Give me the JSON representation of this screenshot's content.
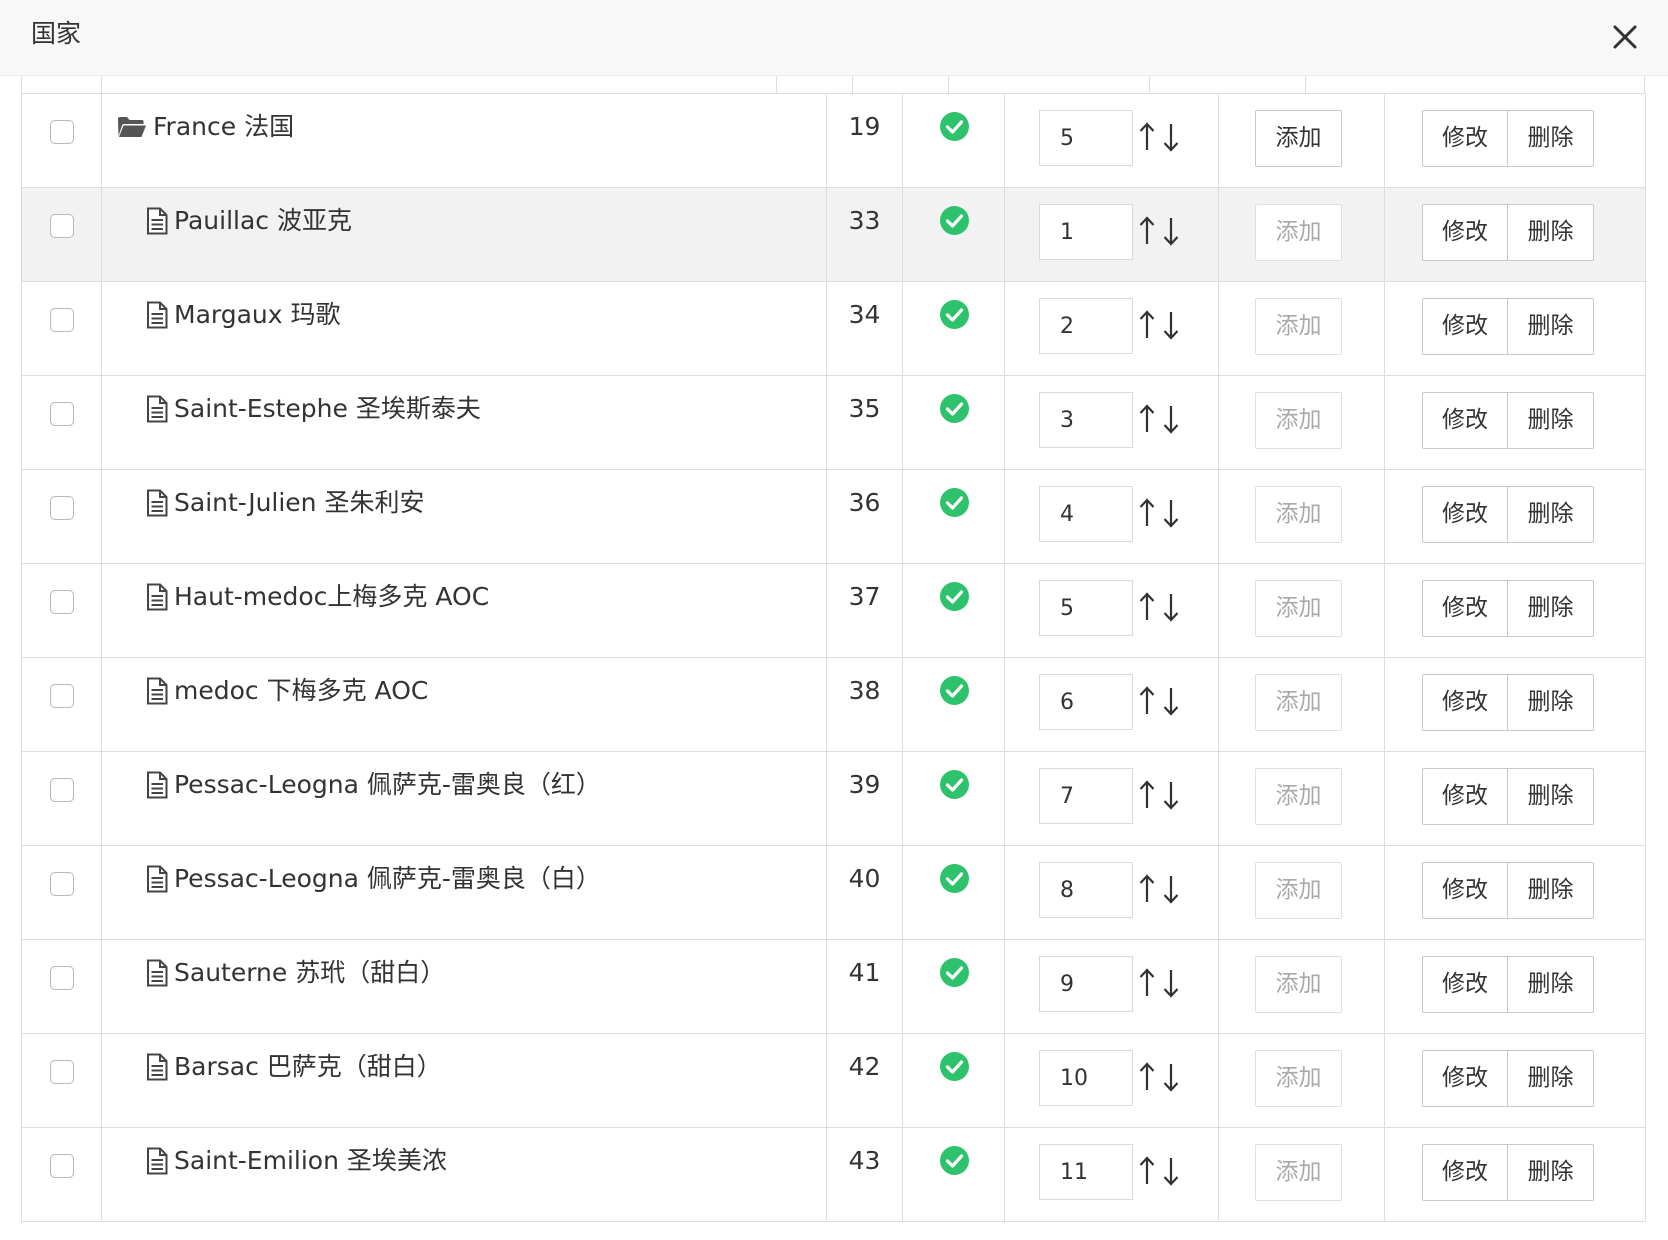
{
  "dialog": {
    "title": "国家"
  },
  "colors": {
    "success": "#2dc26b",
    "highlight_row": "#f2f2f2",
    "border": "#dddddd"
  },
  "icons": {
    "close": "close-icon",
    "root_item": "folder-open-icon",
    "child_item": "file-text-icon",
    "status": "check-circle-icon",
    "sort_up": "arrow-up-icon",
    "sort_down": "arrow-down-icon"
  },
  "labels": {
    "add": "添加",
    "edit": "修改",
    "delete": "删除"
  },
  "rows": [
    {
      "name": "France 法国",
      "id": "19",
      "order": "5",
      "level": "root",
      "add_enabled": true,
      "highlighted": false,
      "checked": false,
      "status": "enabled"
    },
    {
      "name": "Pauillac 波亚克",
      "id": "33",
      "order": "1",
      "level": "child",
      "add_enabled": false,
      "highlighted": true,
      "checked": false,
      "status": "enabled"
    },
    {
      "name": "Margaux 玛歌",
      "id": "34",
      "order": "2",
      "level": "child",
      "add_enabled": false,
      "highlighted": false,
      "checked": false,
      "status": "enabled"
    },
    {
      "name": "Saint-Estephe 圣埃斯泰夫",
      "id": "35",
      "order": "3",
      "level": "child",
      "add_enabled": false,
      "highlighted": false,
      "checked": false,
      "status": "enabled"
    },
    {
      "name": "Saint-Julien 圣朱利安",
      "id": "36",
      "order": "4",
      "level": "child",
      "add_enabled": false,
      "highlighted": false,
      "checked": false,
      "status": "enabled"
    },
    {
      "name": "Haut-medoc上梅多克 AOC",
      "id": "37",
      "order": "5",
      "level": "child",
      "add_enabled": false,
      "highlighted": false,
      "checked": false,
      "status": "enabled"
    },
    {
      "name": "medoc 下梅多克 AOC",
      "id": "38",
      "order": "6",
      "level": "child",
      "add_enabled": false,
      "highlighted": false,
      "checked": false,
      "status": "enabled"
    },
    {
      "name": "Pessac-Leogna 佩萨克-雷奥良（红）",
      "id": "39",
      "order": "7",
      "level": "child",
      "add_enabled": false,
      "highlighted": false,
      "checked": false,
      "status": "enabled"
    },
    {
      "name": "Pessac-Leogna 佩萨克-雷奥良（白）",
      "id": "40",
      "order": "8",
      "level": "child",
      "add_enabled": false,
      "highlighted": false,
      "checked": false,
      "status": "enabled"
    },
    {
      "name": "Sauterne 苏玳（甜白）",
      "id": "41",
      "order": "9",
      "level": "child",
      "add_enabled": false,
      "highlighted": false,
      "checked": false,
      "status": "enabled"
    },
    {
      "name": "Barsac 巴萨克（甜白）",
      "id": "42",
      "order": "10",
      "level": "child",
      "add_enabled": false,
      "highlighted": false,
      "checked": false,
      "status": "enabled"
    },
    {
      "name": "Saint-Emilion 圣埃美浓",
      "id": "43",
      "order": "11",
      "level": "child",
      "add_enabled": false,
      "highlighted": false,
      "checked": false,
      "status": "enabled"
    }
  ]
}
